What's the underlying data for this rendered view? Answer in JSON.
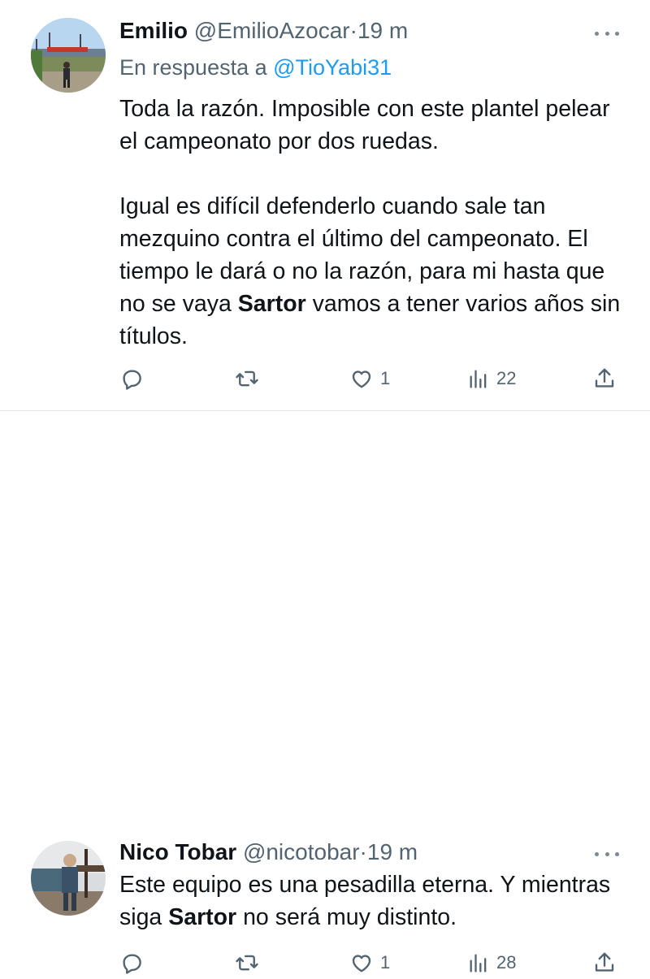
{
  "tweets": [
    {
      "name": "Emilio",
      "handle": "@EmilioAzocar",
      "dot": "·",
      "time": "19 m",
      "reply_prefix": "En respuesta a",
      "reply_to": "@TioYabi31",
      "paragraph1": "Toda la razón. Imposible con este plantel pelear el campeonato por dos ruedas.",
      "paragraph2_before": "Igual es difícil defenderlo cuando sale tan mezquino contra el último del campeonato. El tiempo le dará o no la razón, para mi hasta que no se vaya ",
      "paragraph2_bold": "Sartor",
      "paragraph2_after": " vamos a tener varios años sin títulos.",
      "likes": "1",
      "views": "22"
    },
    {
      "name": "Nico Tobar",
      "handle": "@nicotobar",
      "dot": "·",
      "time": "19 m",
      "text_before": "Este equipo es una pesadilla eterna. Y mientras siga ",
      "text_bold": "Sartor",
      "text_after": " no será muy distinto.",
      "likes": "1",
      "views": "28"
    }
  ],
  "colors": {
    "primary_text": "#0f1419",
    "secondary_text": "#536471",
    "link": "#1d9bf0",
    "divider": "#e3e6e9"
  },
  "icons": [
    "reply-icon",
    "retweet-icon",
    "like-icon",
    "views-icon",
    "share-icon",
    "more-options-icon"
  ]
}
